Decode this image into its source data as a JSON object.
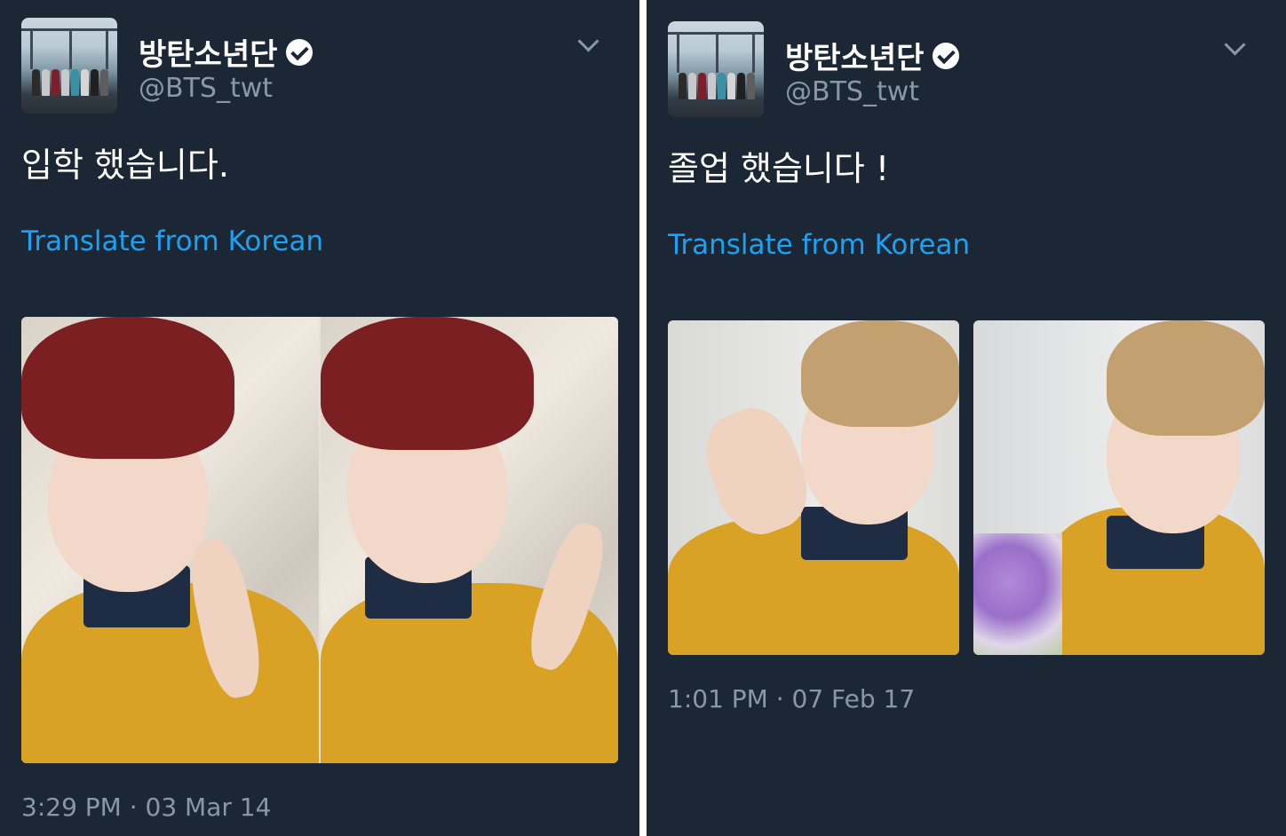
{
  "tweets": [
    {
      "display_name": "방탄소년단",
      "handle": "@BTS_twt",
      "text": "입학 했습니다.",
      "translate_label": "Translate from Korean",
      "timestamp": "3:29 PM · 03 Mar 14"
    },
    {
      "display_name": "방탄소년단",
      "handle": "@BTS_twt",
      "text": "졸업 했습니다 !",
      "translate_label": "Translate from Korean",
      "timestamp": "1:01 PM · 07 Feb 17"
    }
  ],
  "icons": {
    "verified": "verified-badge-icon",
    "menu": "chevron-down-icon"
  },
  "colors": {
    "background": "#1b2735",
    "name": "#ffffff",
    "secondary": "#8899a6",
    "link": "#1da1f2"
  }
}
